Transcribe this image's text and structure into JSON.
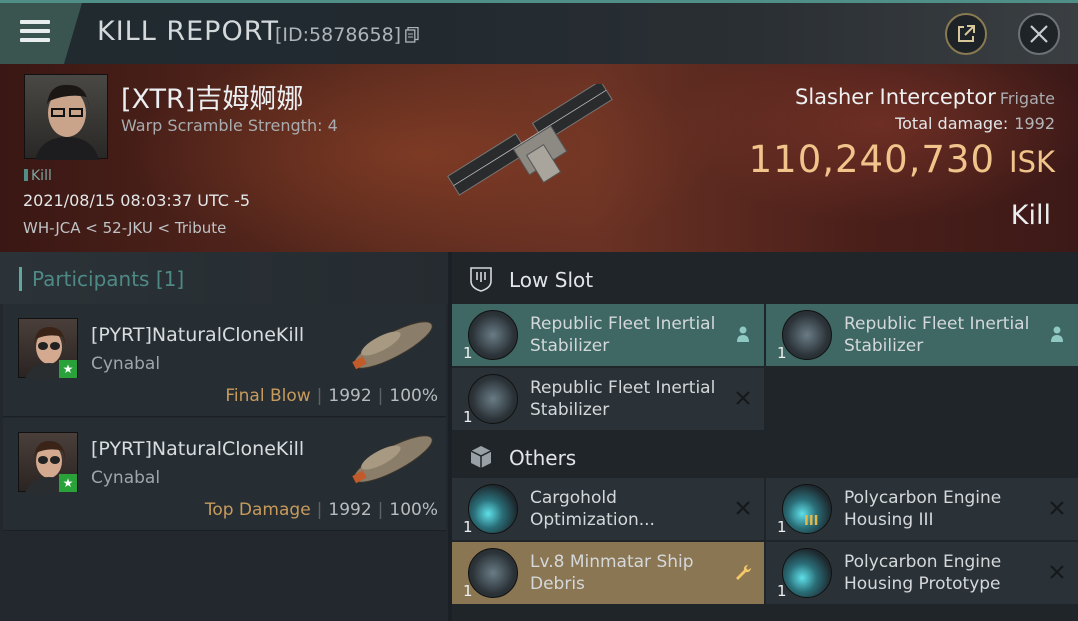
{
  "header": {
    "title": "KILL REPORT",
    "report_id": "[ID:5878658]"
  },
  "victim": {
    "name": "[XTR]吉姆婀娜",
    "subtitle": "Warp Scramble Strength: 4",
    "tag": "Kill",
    "timestamp": "2021/08/15 08:03:37 UTC -5",
    "location": "WH-JCA < 52-JKU < Tribute"
  },
  "ship": {
    "name": "Slasher Interceptor",
    "class": "Frigate",
    "damage_label": "Total damage:",
    "damage_value": "1992",
    "isk_value": "110,240,730",
    "isk_unit": "ISK",
    "result": "Kill"
  },
  "participants": {
    "title": "Participants [1]",
    "rows": [
      {
        "name": "[PYRT]NaturalCloneKill",
        "ship": "Cynabal",
        "role": "Final Blow",
        "damage": "1992",
        "percent": "100%"
      },
      {
        "name": "[PYRT]NaturalCloneKill",
        "ship": "Cynabal",
        "role": "Top Damage",
        "damage": "1992",
        "percent": "100%"
      }
    ]
  },
  "sections": {
    "low_slot": {
      "title": "Low Slot",
      "items": [
        {
          "name": "Republic Fleet Inertial Stabilizer",
          "qty": "1",
          "status": "dropped",
          "icon": "stabilizer-icon"
        },
        {
          "name": "Republic Fleet Inertial Stabilizer",
          "qty": "1",
          "status": "dropped",
          "icon": "stabilizer-icon"
        },
        {
          "name": "Republic Fleet Inertial Stabilizer",
          "qty": "1",
          "status": "destroyed",
          "icon": "stabilizer-icon"
        }
      ]
    },
    "others": {
      "title": "Others",
      "items": [
        {
          "name": "Cargohold Optimization...",
          "qty": "1",
          "status": "destroyed",
          "icon": "rig-icon"
        },
        {
          "name": "Polycarbon Engine Housing III",
          "qty": "1",
          "tier": "III",
          "status": "destroyed",
          "icon": "rig-icon"
        },
        {
          "name": "Lv.8 Minmatar Ship Debris",
          "qty": "1",
          "status": "salvage",
          "icon": "debris-icon"
        },
        {
          "name": "Polycarbon Engine Housing Prototype",
          "qty": "1",
          "status": "destroyed",
          "icon": "rig-icon"
        }
      ]
    }
  },
  "colors": {
    "accent": "#4f8f88",
    "isk": "#f0c48a",
    "dropped_bg": "#3f6764",
    "salvage_bg": "#8a7652"
  }
}
